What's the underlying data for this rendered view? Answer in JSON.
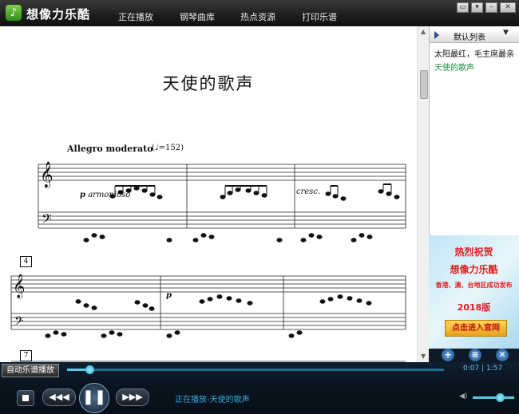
{
  "app": {
    "title": "想像力乐酷",
    "logo_glyph": "♪"
  },
  "nav": [
    "正在播放",
    "钢琴曲库",
    "热点资源",
    "打印乐谱"
  ],
  "window_controls": [
    "▭",
    "▾",
    "–",
    "✕"
  ],
  "score": {
    "title": "天使的歌声",
    "tempo_text": "Allegro moderato",
    "tempo_mark": "(♩=152)",
    "expression_1": "armonioso",
    "dynamic_p": "p",
    "expression_2": "cresc.",
    "system_numbers": [
      "4",
      "7"
    ]
  },
  "playlist": {
    "title": "默认列表",
    "dropdown_glyph": "▼",
    "items": [
      "太阳最红，毛主席最亲",
      "天使的歌声"
    ]
  },
  "ad": {
    "headline": "热烈祝贺",
    "brand": "想像力乐酷",
    "line": "香港、澳、台地区成功发布",
    "version": "2018版",
    "button": "点击进入官网"
  },
  "playlist_tools": [
    "+",
    "≡",
    "✕"
  ],
  "player": {
    "autoplay_label": "自动乐谱播放",
    "elapsed": "0:07",
    "separator": "|",
    "total": "1:57",
    "progress": 0.06,
    "volume": 0.65,
    "now_playing": "正在播放-天使的歌声",
    "prev_glyph": "◀◀◀",
    "play_glyph": "❚❚",
    "next_glyph": "▶▶▶",
    "volume_glyph": "◀)"
  },
  "colors": {
    "accent": "#58c9e6",
    "now_playing": "#3aa8d8",
    "selected_item": "#1a8a3a",
    "ad_red": "#e02020"
  }
}
